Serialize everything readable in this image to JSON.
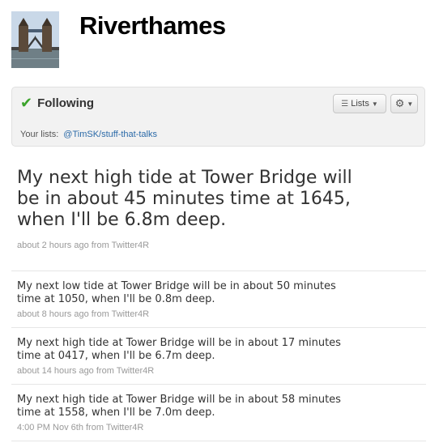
{
  "profile": {
    "username": "Riverthames",
    "avatar_icon": "tower-bridge-photo"
  },
  "follow": {
    "status_label": "Following",
    "check_icon": "check-icon",
    "lists_button": "Lists",
    "gear_icon": "gear-icon",
    "your_lists_label": "Your lists:",
    "list_link": "@TimSK/stuff-that-talks"
  },
  "featured_tweet": {
    "text": "My next high tide at Tower Bridge will be in about 45 minutes time at 1645, when I'll be 6.8m deep.",
    "meta": "about 2 hours ago from Twitter4R"
  },
  "tweets": [
    {
      "text": "My next low tide at Tower Bridge will be in about 50 minutes time at 1050, when I'll be 0.8m deep.",
      "meta": "about 8 hours ago from Twitter4R"
    },
    {
      "text": "My next high tide at Tower Bridge will be in about 17 minutes time at 0417, when I'll be 6.7m deep.",
      "meta": "about 14 hours ago from Twitter4R"
    },
    {
      "text": "My next high tide at Tower Bridge will be in about 58 minutes time at 1558, when I'll be 7.0m deep.",
      "meta": "4:00 PM Nov 6th from Twitter4R"
    }
  ],
  "colors": {
    "check": "#3aa32a",
    "link": "#2b6aa8",
    "meta": "#999999"
  }
}
